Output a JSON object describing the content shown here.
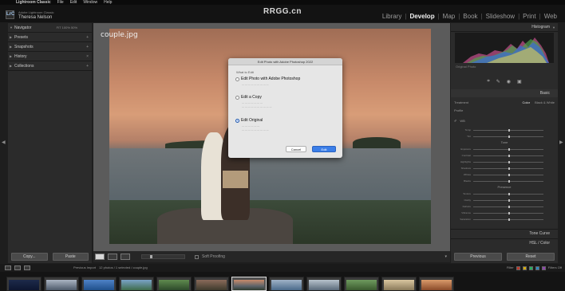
{
  "menubar": {
    "app_name": "Lightroom Classic",
    "items": [
      "File",
      "Edit",
      "Window",
      "Help"
    ]
  },
  "header": {
    "logo_text": "LrC",
    "identity_small": "Adobe Lightroom Classic",
    "identity_user": "Theresa Nelson",
    "watermark": "RRGG.cn",
    "modules": [
      "Library",
      "Develop",
      "Map",
      "Book",
      "Slideshow",
      "Print",
      "Web"
    ],
    "active_module": "Develop"
  },
  "left_panel": {
    "sections": [
      {
        "label": "Navigator",
        "options": "FIT  100%  50%"
      },
      {
        "label": "Presets",
        "options": ""
      },
      {
        "label": "Snapshots",
        "options": ""
      },
      {
        "label": "History",
        "options": ""
      },
      {
        "label": "Collections",
        "options": ""
      }
    ],
    "copy_button": "Copy...",
    "paste_button": "Paste"
  },
  "main": {
    "photo_name": "couple.jpg"
  },
  "dialog": {
    "title": "Edit Photo with Adobe Photoshop 2022",
    "section_label": "What to Edit",
    "options": [
      {
        "label": "Edit Photo with Adobe Photoshop",
        "checked": false
      },
      {
        "label": "Edit a Copy",
        "checked": false
      },
      {
        "label": "Edit Original",
        "checked": true
      }
    ],
    "cancel_label": "Cancel",
    "edit_label": "Edit"
  },
  "toolbar": {
    "softproofing_label": "Soft Proofing"
  },
  "right_panel": {
    "histogram_label": "Histogram",
    "original_photo_label": "Original Photo",
    "basic_label": "Basic",
    "treatment_label": "Treatment",
    "treatment_color": "Color",
    "treatment_bw": "Black & White",
    "profile_label": "Profile",
    "wb_label": "WB",
    "tone_label": "Tone",
    "presence_label": "Presence",
    "slider_labels": [
      "Temp",
      "Tint",
      "Exposure",
      "Contrast",
      "Highlights",
      "Shadows",
      "Whites",
      "Blacks",
      "Texture",
      "Clarity",
      "Dehaze",
      "Vibrance",
      "Saturation"
    ],
    "tone_curve_label": "Tone Curve",
    "hsl_label": "HSL / Color",
    "previous_button": "Previous",
    "reset_button": "Reset"
  },
  "filmstrip": {
    "crumb": "Previous Import",
    "count_text": "12 photos / 1 selected / couple.jpg",
    "filter_label": "Filter",
    "filter_value": "Filters Off",
    "thumb_count": 12
  },
  "colors": {
    "accent": "#3b7ee8",
    "panel": "#2b2b2b",
    "background": "#1e1e1e"
  }
}
